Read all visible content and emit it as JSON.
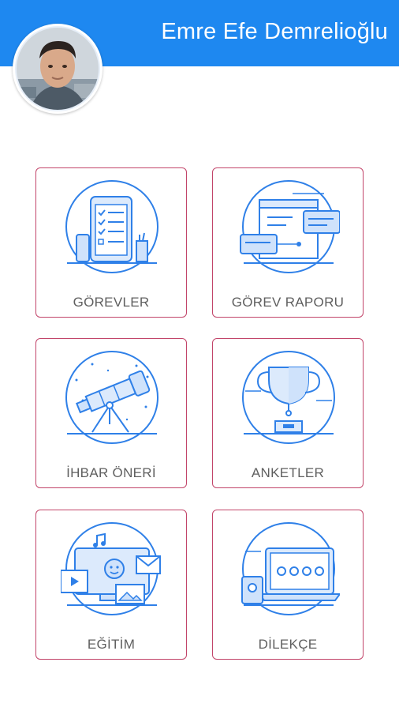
{
  "header": {
    "user_name": "Emre Efe Demrelioğlu",
    "background_color": "#1e88f0"
  },
  "avatar": {
    "icon": "user-photo"
  },
  "menu": {
    "items": [
      {
        "label": "GÖREVLER",
        "icon": "task-checklist-phone-icon"
      },
      {
        "label": "GÖREV RAPORU",
        "icon": "report-chat-window-icon"
      },
      {
        "label": "İHBAR ÖNERİ",
        "icon": "telescope-icon"
      },
      {
        "label": "ANKETLER",
        "icon": "trophy-icon"
      },
      {
        "label": "EĞİTİM",
        "icon": "media-education-icon"
      },
      {
        "label": "DİLEKÇE",
        "icon": "laptop-petition-icon"
      }
    ],
    "card_border_color": "#c2456a",
    "icon_color": "#2f80e8"
  }
}
